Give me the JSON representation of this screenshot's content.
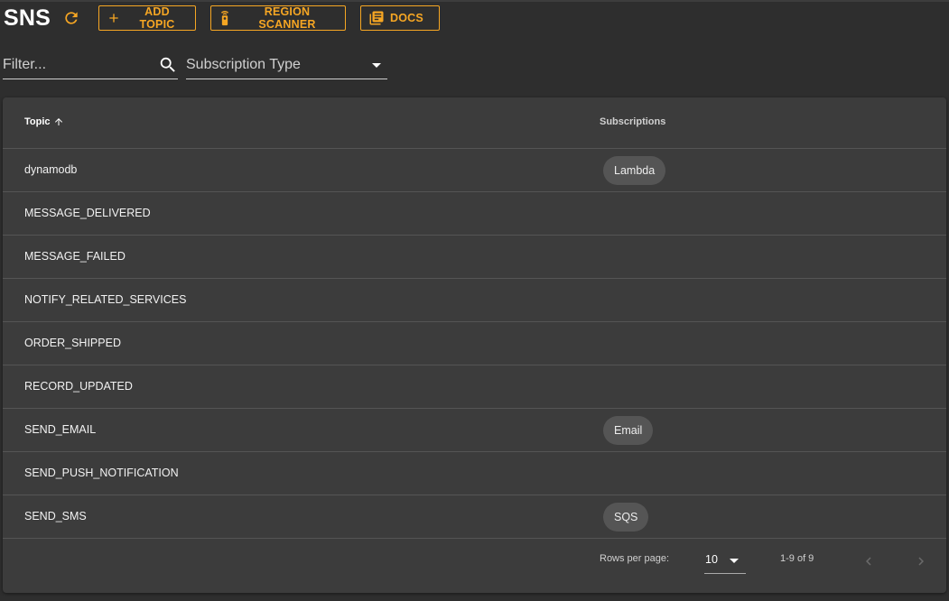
{
  "header": {
    "title": "SNS",
    "refresh_icon": "refresh-icon",
    "accent_color": "#f6a623",
    "buttons": {
      "add_topic": "ADD TOPIC",
      "region_scanner": "REGION SCANNER",
      "docs": "DOCS"
    }
  },
  "filters": {
    "filter_placeholder": "Filter...",
    "subscription_type_label": "Subscription Type"
  },
  "table": {
    "columns": {
      "topic": "Topic",
      "subscriptions": "Subscriptions"
    },
    "sort": {
      "column": "topic",
      "direction": "ascending"
    },
    "rows": [
      {
        "topic": "dynamodb",
        "subscription": "Lambda"
      },
      {
        "topic": "MESSAGE_DELIVERED",
        "subscription": ""
      },
      {
        "topic": "MESSAGE_FAILED",
        "subscription": ""
      },
      {
        "topic": "NOTIFY_RELATED_SERVICES",
        "subscription": ""
      },
      {
        "topic": "ORDER_SHIPPED",
        "subscription": ""
      },
      {
        "topic": "RECORD_UPDATED",
        "subscription": ""
      },
      {
        "topic": "SEND_EMAIL",
        "subscription": "Email"
      },
      {
        "topic": "SEND_PUSH_NOTIFICATION",
        "subscription": ""
      },
      {
        "topic": "SEND_SMS",
        "subscription": "SQS"
      }
    ]
  },
  "pagination": {
    "rows_per_page_label": "Rows per page:",
    "rows_per_page": "10",
    "range": "1-9 of 9"
  }
}
